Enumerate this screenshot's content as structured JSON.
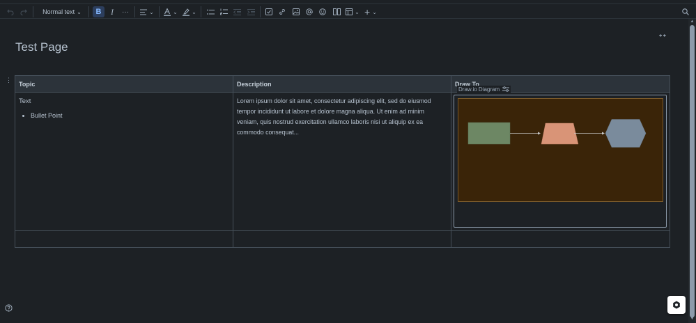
{
  "toolbar": {
    "text_style": "Normal text",
    "icons": [
      "undo-icon",
      "redo-icon",
      "bold-icon",
      "italic-icon",
      "more-formatting-icon",
      "align-icon",
      "text-color-icon",
      "highlight-icon",
      "bullet-list-icon",
      "numbered-list-icon",
      "outdent-icon",
      "indent-icon",
      "task-icon",
      "link-icon",
      "image-icon",
      "mention-icon",
      "emoji-icon",
      "layout-icon",
      "table-icon",
      "insert-icon",
      "search-icon"
    ],
    "colors": {
      "text_color_bar": "#8c9bab",
      "highlight_bar": "#8c9bab"
    }
  },
  "page": {
    "title": "Test Page"
  },
  "table": {
    "headers": [
      "Topic",
      "Description",
      "Draw To"
    ],
    "row1": {
      "topic_text": "Text",
      "bullets": [
        "Bullet Point"
      ],
      "description": "Lorem ipsum dolor sit amet, consectetur adipiscing elit, sed do eiusmod tempor incididunt ut labore et dolore magna aliqua. Ut enim ad minim veniam, quis nostrud exercitation ullamco laboris nisi ut aliquip ex ea commodo consequat..."
    }
  },
  "macro": {
    "label": "Draw.io Diagram",
    "icon": "settings-sliders-icon",
    "diagram": {
      "canvas_color": "#3a2408",
      "shapes": [
        {
          "kind": "rectangle",
          "fill": "#6d8764"
        },
        {
          "kind": "trapezoid",
          "fill": "#d99477"
        },
        {
          "kind": "hexagon",
          "fill": "#7a8b9c"
        }
      ],
      "arrow_color": "#c9c9c9"
    }
  },
  "misc": {
    "help_icon": "help-icon",
    "fab_icon": "assistant-icon",
    "collapse_icon": "collapse-width-icon"
  }
}
